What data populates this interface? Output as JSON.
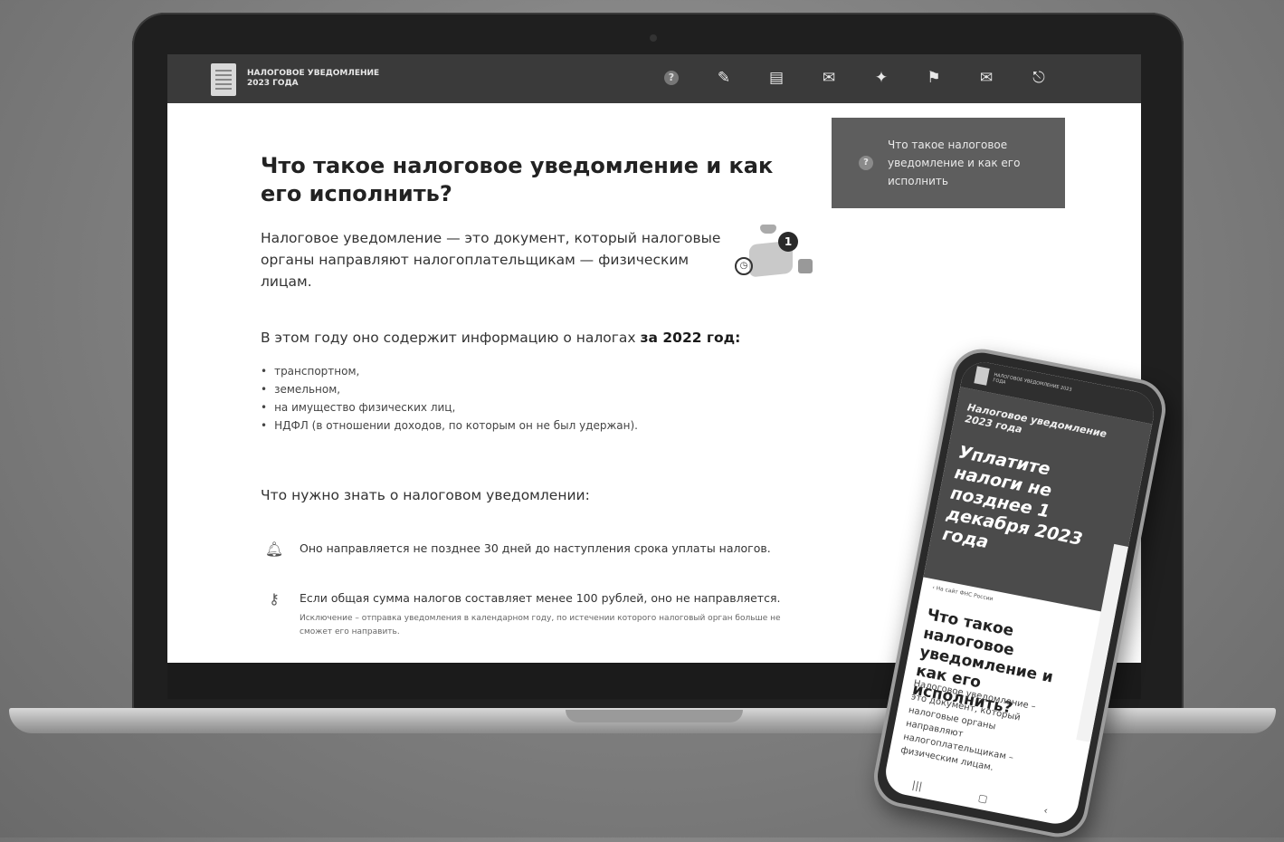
{
  "header": {
    "title_line1": "НАЛОГОВОЕ УВЕДОМЛЕНИЕ",
    "title_line2": "2023 ГОДА",
    "nav_icons": [
      "question-icon",
      "pencil-icon",
      "clipboard-icon",
      "envelope-icon",
      "pin-icon",
      "flag-icon",
      "mail-send-icon",
      "exit-icon"
    ]
  },
  "content": {
    "title": "Что такое налоговое уведомление и как его исполнить?",
    "intro": "Налоговое уведомление — это документ, который налоговые органы направляют налогоплательщикам — физическим лицам.",
    "illustration_badge": "1",
    "year_line_prefix": "В этом году оно содержит информацию о налогах ",
    "year_line_bold": "за 2022 год:",
    "tax_items": [
      "транспортном,",
      "земельном,",
      "на имущество физических лиц,",
      "НДФЛ (в отношении доходов, по которым он не был удержан)."
    ],
    "know_heading": "Что нужно знать о налоговом уведомлении:",
    "fact1": "Оно направляется не позднее 30 дней до наступления срока уплаты налогов.",
    "fact2": "Если общая сумма налогов составляет менее 100 рублей, оно не направляется.",
    "fact2_note": "Исключение – отправка уведомления в календарном году, по истечении которого налоговый орган больше не сможет его направить."
  },
  "sidebar": {
    "card_label": "Что такое налоговое уведомление и как его исполнить"
  },
  "phone": {
    "header_text": "НАЛОГОВОЕ УВЕДОМЛЕНИЕ 2023 ГОДА",
    "hero_sub": "Налоговое уведомление 2023 года",
    "hero_big": "Уплатите налоги не позднее 1 декабря 2023 года",
    "back_link": "На сайт ФНС России",
    "title": "Что такое налоговое уведомление и как его исполнить?",
    "text": "Налоговое уведомление – это документ, который налоговые органы направляют налогоплательщикам – физическим лицам."
  },
  "colors": {
    "header_bg": "#3a3a3a",
    "card_bg": "#5e5e5e",
    "hero_bg": "#4b4b4b"
  }
}
